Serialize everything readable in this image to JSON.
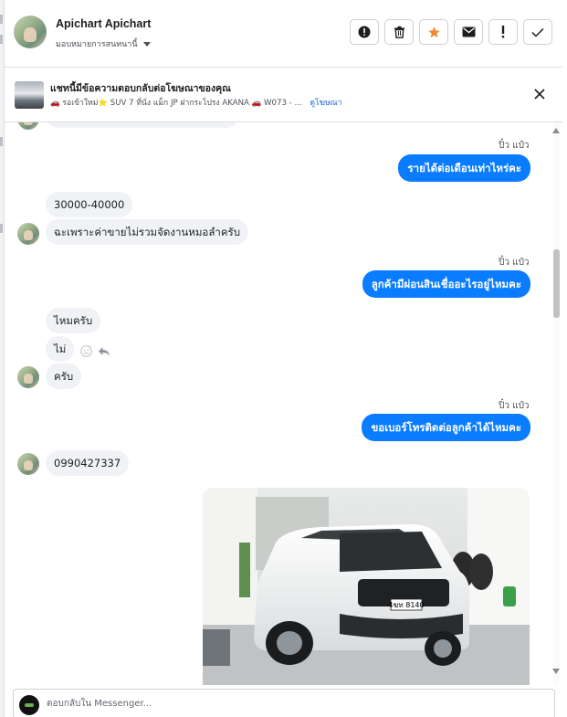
{
  "header": {
    "contact_name": "Apichart Apichart",
    "assign_label": "มอบหมายการสนทนานี้",
    "actions": [
      {
        "icon": "alert-circle-icon",
        "label": "Mark as spam"
      },
      {
        "icon": "trash-icon",
        "label": "Delete"
      },
      {
        "icon": "star-icon",
        "label": "Star"
      },
      {
        "icon": "envelope-icon",
        "label": "Mark unread"
      },
      {
        "icon": "exclamation-icon",
        "label": "Follow up"
      },
      {
        "icon": "check-icon",
        "label": "Mark done"
      }
    ]
  },
  "ad_banner": {
    "title": "แชทนี้มีข้อความตอบกลับต่อโฆษณาของคุณ",
    "subtitle": "🚗 รอเข้าใหม่⭐ SUV 7 ที่นั่ง แม็ก JP ฝากระโปรง AKANA 🚗 W073 - ...",
    "link": "ดูโฆษณา"
  },
  "messages": [
    {
      "side": "out",
      "sender": "ปิ๋ว แป๋ว",
      "text": "รายได้ต่อเดือนเท่าไหร่คะ"
    },
    {
      "side": "in",
      "text": "30000-40000"
    },
    {
      "side": "in",
      "text": "ฉะเพราะค่าขายไม่รวมจัดงานหมอลำครับ"
    },
    {
      "side": "out",
      "sender": "ปิ๋ว แป๋ว",
      "text": "ลูกค้ามีผ่อนสินเชื่ออะไรอยู่ไหมคะ"
    },
    {
      "side": "in",
      "text": "ไหมครับ"
    },
    {
      "side": "in",
      "text": "ไม่"
    },
    {
      "side": "in",
      "text": "ครับ"
    },
    {
      "side": "out",
      "sender": "ปิ๋ว แป๋ว",
      "text": "ขอเบอร์โทรติดต่อลูกค้าได้ไหมคะ"
    },
    {
      "side": "in",
      "text": "0990427337"
    }
  ],
  "photo": {
    "plate": "4ฆท 8140"
  },
  "composer": {
    "placeholder": "ตอบกลับใน Messenger..."
  },
  "colors": {
    "outgoing_bubble": "#0a7cff",
    "incoming_bubble": "#f0f2f5",
    "star": "#f28b2c",
    "link": "#1763cf"
  }
}
